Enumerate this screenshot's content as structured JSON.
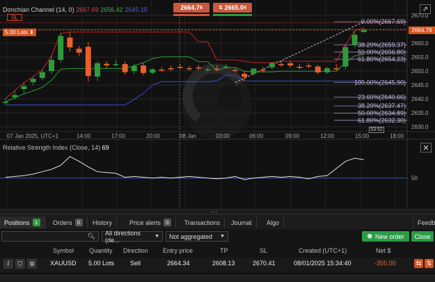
{
  "chart": {
    "indicator_label": "Donchian Channel (14, 0)",
    "dc_upper": "2667.69",
    "dc_middle": "2656.42",
    "dc_lower": "2645.15",
    "order_badge": "SL",
    "lot_label": "5.00 Lots",
    "sell_price": "2664.7",
    "sell_price_sup": "9",
    "buy_price": "2665.0",
    "buy_price_sup": "4",
    "current_price": "2664.79",
    "price_ticks": [
      "2670.0",
      "2665.0",
      "2660.0",
      "2655.0",
      "2650.0",
      "2645.0",
      "2640.0",
      "2635.0",
      "2630.0"
    ],
    "price_tick_values": [
      2670,
      2665,
      2660,
      2655,
      2650,
      2645,
      2640,
      2635,
      2630
    ],
    "time_labels": [
      "07 Jan 2025, UTC+1",
      "14:00",
      "17:00",
      "20:00",
      "08 Jan",
      "03:00",
      "06:00",
      "09:00",
      "12:00",
      "15:00",
      "18:00"
    ],
    "countdown": "53:52",
    "fib_levels": [
      {
        "label": "0.00%(2667.69)",
        "value": 2667.69
      },
      {
        "label": "38.20%(2659.37)",
        "value": 2659.37
      },
      {
        "label": "50.00%(2656.80)",
        "value": 2656.8
      },
      {
        "label": "61.80%(2654.23)",
        "value": 2654.23
      },
      {
        "label": "100.00%(2645.90)",
        "value": 2645.9
      },
      {
        "label": "23.60%(2640.66)",
        "value": 2640.66
      },
      {
        "label": "38.20%(2637.47)",
        "value": 2637.47
      },
      {
        "label": "50.00%(2634.89)",
        "value": 2634.89
      },
      {
        "label": "61.80%(2632.30)",
        "value": 2632.3
      }
    ],
    "candles": [
      {
        "o": 2638.5,
        "h": 2640.2,
        "c": 2638.9,
        "l": 2637.8
      },
      {
        "o": 2640.6,
        "h": 2643.0,
        "c": 2641.4,
        "l": 2639.8
      },
      {
        "o": 2643.5,
        "h": 2645.8,
        "c": 2644.6,
        "l": 2642.0
      },
      {
        "o": 2646.0,
        "h": 2648.0,
        "c": 2647.2,
        "l": 2645.0
      },
      {
        "o": 2647.5,
        "h": 2650.5,
        "c": 2649.6,
        "l": 2646.8
      },
      {
        "o": 2650.0,
        "h": 2655.5,
        "c": 2654.0,
        "l": 2649.0
      },
      {
        "o": 2654.0,
        "h": 2663.5,
        "c": 2662.6,
        "l": 2653.0
      },
      {
        "o": 2662.0,
        "h": 2664.0,
        "c": 2658.5,
        "l": 2657.0
      },
      {
        "o": 2658.0,
        "h": 2659.0,
        "c": 2656.6,
        "l": 2655.5
      },
      {
        "o": 2658.7,
        "h": 2660.5,
        "c": 2648.2,
        "l": 2646.2
      },
      {
        "o": 2648.0,
        "h": 2653.5,
        "c": 2652.8,
        "l": 2646.5
      },
      {
        "o": 2652.6,
        "h": 2653.5,
        "c": 2652.0,
        "l": 2651.0
      },
      {
        "o": 2652.5,
        "h": 2654.0,
        "c": 2652.5,
        "l": 2651.6
      },
      {
        "o": 2652.5,
        "h": 2653.5,
        "c": 2649.6,
        "l": 2648.8
      },
      {
        "o": 2650.0,
        "h": 2652.5,
        "c": 2651.8,
        "l": 2649.0
      },
      {
        "o": 2652.0,
        "h": 2653.0,
        "c": 2649.3,
        "l": 2648.5
      },
      {
        "o": 2649.4,
        "h": 2651.0,
        "c": 2650.6,
        "l": 2648.8
      },
      {
        "o": 2650.5,
        "h": 2651.5,
        "c": 2650.2,
        "l": 2649.6
      },
      {
        "o": 2651.0,
        "h": 2652.0,
        "c": 2650.6,
        "l": 2650.0
      },
      {
        "o": 2651.5,
        "h": 2652.5,
        "c": 2651.3,
        "l": 2650.7
      },
      {
        "o": 2651.0,
        "h": 2651.8,
        "c": 2650.8,
        "l": 2650.0
      },
      {
        "o": 2651.3,
        "h": 2652.2,
        "c": 2651.2,
        "l": 2650.5
      },
      {
        "o": 2650.5,
        "h": 2651.3,
        "c": 2650.6,
        "l": 2649.8
      },
      {
        "o": 2650.8,
        "h": 2652.0,
        "c": 2650.7,
        "l": 2650.0
      },
      {
        "o": 2651.5,
        "h": 2652.5,
        "c": 2651.6,
        "l": 2650.8
      },
      {
        "o": 2650.4,
        "h": 2651.5,
        "c": 2650.3,
        "l": 2649.5
      },
      {
        "o": 2649.0,
        "h": 2650.0,
        "c": 2647.9,
        "l": 2646.4
      },
      {
        "o": 2649.0,
        "h": 2651.0,
        "c": 2650.9,
        "l": 2648.5
      },
      {
        "o": 2650.5,
        "h": 2651.5,
        "c": 2650.4,
        "l": 2649.7
      },
      {
        "o": 2651.3,
        "h": 2653.0,
        "c": 2652.9,
        "l": 2650.5
      },
      {
        "o": 2652.5,
        "h": 2653.5,
        "c": 2652.4,
        "l": 2651.5
      },
      {
        "o": 2652.8,
        "h": 2653.5,
        "c": 2652.0,
        "l": 2651.2
      },
      {
        "o": 2651.5,
        "h": 2652.5,
        "c": 2651.4,
        "l": 2650.8
      },
      {
        "o": 2652.0,
        "h": 2652.8,
        "c": 2651.9,
        "l": 2651.0
      },
      {
        "o": 2651.6,
        "h": 2652.2,
        "c": 2649.5,
        "l": 2648.8
      },
      {
        "o": 2649.5,
        "h": 2651.5,
        "c": 2651.0,
        "l": 2649.0
      },
      {
        "o": 2651.0,
        "h": 2652.5,
        "c": 2650.9,
        "l": 2650.2
      },
      {
        "o": 2651.6,
        "h": 2659.5,
        "c": 2658.6,
        "l": 2650.5
      },
      {
        "o": 2659.4,
        "h": 2664.5,
        "c": 2663.0,
        "l": 2658.5
      },
      {
        "o": 2664.0,
        "h": 2665.5,
        "c": 2664.79,
        "l": 2663.6
      }
    ],
    "rsi_label": "Relative Strength Index (Close, 14)",
    "rsi_value": "69",
    "rsi_level_label": "50",
    "rsi_values": [
      51,
      52,
      53,
      55,
      58,
      61,
      66,
      77,
      71,
      64,
      58,
      57,
      56,
      51,
      52,
      51,
      50,
      51,
      50,
      51,
      52,
      51,
      50,
      49,
      50,
      52,
      48,
      50,
      51,
      52,
      51,
      52,
      51,
      49,
      52,
      53,
      62,
      71,
      75,
      73
    ]
  },
  "panel": {
    "tabs": [
      {
        "label": "Positions",
        "badge": "1",
        "active": true
      },
      {
        "label": "Orders",
        "badge": "0",
        "active": false
      },
      {
        "label": "History",
        "badge": "",
        "active": false
      },
      {
        "label": "Price alerts",
        "badge": "0",
        "active": false
      },
      {
        "label": "Transactions",
        "badge": "",
        "active": false
      },
      {
        "label": "Journal",
        "badge": "",
        "active": false
      },
      {
        "label": "Algo",
        "badge": "",
        "active": false
      }
    ],
    "feedback_label": "Feedb",
    "directions_select": "All directions (de...",
    "aggregation_select": "Not aggregated",
    "new_order_label": "New order",
    "close_label": "Close",
    "columns": [
      "Symbol",
      "Quantity",
      "Direction",
      "Entry price",
      "TP",
      "SL",
      "Created (UTC+1)",
      "Net $"
    ],
    "row": {
      "symbol": "XAUUSD",
      "quantity": "5.00 Lots",
      "direction": "Sell",
      "entry_price": "2664.34",
      "tp": "2608.13",
      "sl": "2670.41",
      "created": "08/01/2025 15:34:40",
      "net": "-355.00"
    }
  },
  "colors": {
    "bull": "#2f9a3a",
    "bear": "#e8602c",
    "dc_upper": "#d02020",
    "dc_middle": "#2f9a3a",
    "dc_lower": "#3a4fd0",
    "fib": "#9b8fc0",
    "net_negative": "#e86a2c",
    "accent_green": "#2b9b47"
  }
}
